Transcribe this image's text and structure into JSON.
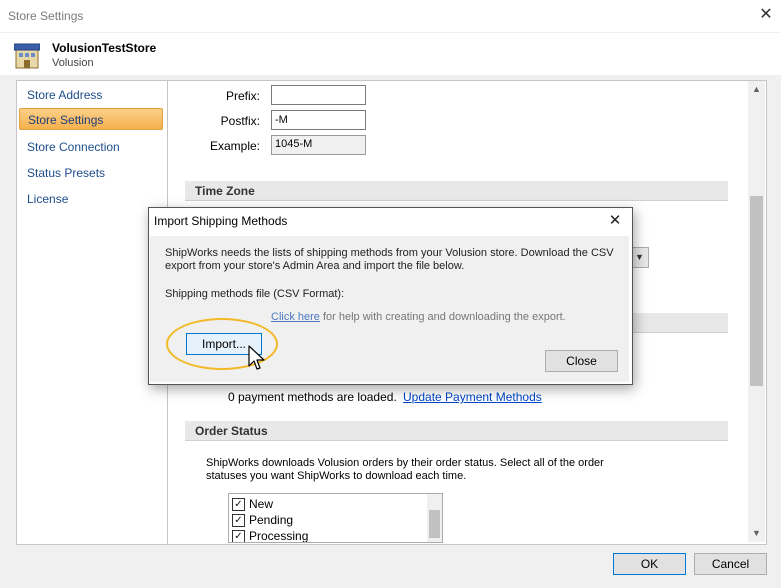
{
  "window": {
    "title": "Store Settings",
    "close_glyph": "✕"
  },
  "store": {
    "name": "VolusionTestStore",
    "platform": "Volusion",
    "icon": "store-building-icon"
  },
  "sidebar": {
    "items": [
      {
        "label": "Store Address",
        "active": false
      },
      {
        "label": "Store Settings",
        "active": true
      },
      {
        "label": "Store Connection",
        "active": false
      },
      {
        "label": "Status Presets",
        "active": false
      },
      {
        "label": "License",
        "active": false
      }
    ]
  },
  "order_number": {
    "prefix_label": "Prefix:",
    "prefix_value": "",
    "postfix_label": "Postfix:",
    "postfix_value": "-M",
    "example_label": "Example:",
    "example_value": "1045-M"
  },
  "time_zone": {
    "header": "Time Zone"
  },
  "payment": {
    "loaded_text": "0 payment methods are loaded.",
    "update_link": "Update Payment Methods"
  },
  "order_status": {
    "header": "Order Status",
    "description_line1": "ShipWorks downloads Volusion orders by their order status. Select all of the order",
    "description_line2": "statuses you want ShipWorks to download each time.",
    "statuses": [
      {
        "label": "New",
        "checked": true
      },
      {
        "label": "Pending",
        "checked": true
      },
      {
        "label": "Processing",
        "checked": true
      }
    ]
  },
  "footer": {
    "ok_label": "OK",
    "cancel_label": "Cancel"
  },
  "dialog": {
    "title": "Import Shipping Methods",
    "close_glyph": "✕",
    "message_line1": "ShipWorks needs the lists of shipping methods from your Volusion store.  Download the CSV",
    "message_line2": "export from your store's Admin Area and import the file below.",
    "file_label": "Shipping methods file (CSV Format):",
    "import_label": "Import...",
    "help_link": "Click here",
    "help_text": " for help with creating and downloading the export.",
    "close_label": "Close"
  },
  "colors": {
    "accent": "#0078d7",
    "nav_active": "#f5b04c",
    "highlight_ring": "#f2b928",
    "link": "#0046c8"
  }
}
